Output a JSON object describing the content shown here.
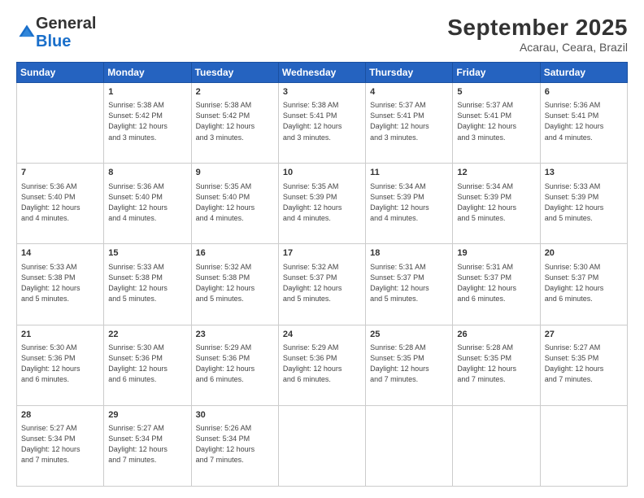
{
  "header": {
    "logo": {
      "line1": "General",
      "line2": "Blue"
    },
    "title": "September 2025",
    "location": "Acarau, Ceara, Brazil"
  },
  "weekdays": [
    "Sunday",
    "Monday",
    "Tuesday",
    "Wednesday",
    "Thursday",
    "Friday",
    "Saturday"
  ],
  "weeks": [
    [
      {
        "day": "",
        "info": ""
      },
      {
        "day": "1",
        "info": "Sunrise: 5:38 AM\nSunset: 5:42 PM\nDaylight: 12 hours\nand 3 minutes."
      },
      {
        "day": "2",
        "info": "Sunrise: 5:38 AM\nSunset: 5:42 PM\nDaylight: 12 hours\nand 3 minutes."
      },
      {
        "day": "3",
        "info": "Sunrise: 5:38 AM\nSunset: 5:41 PM\nDaylight: 12 hours\nand 3 minutes."
      },
      {
        "day": "4",
        "info": "Sunrise: 5:37 AM\nSunset: 5:41 PM\nDaylight: 12 hours\nand 3 minutes."
      },
      {
        "day": "5",
        "info": "Sunrise: 5:37 AM\nSunset: 5:41 PM\nDaylight: 12 hours\nand 3 minutes."
      },
      {
        "day": "6",
        "info": "Sunrise: 5:36 AM\nSunset: 5:41 PM\nDaylight: 12 hours\nand 4 minutes."
      }
    ],
    [
      {
        "day": "7",
        "info": "Sunrise: 5:36 AM\nSunset: 5:40 PM\nDaylight: 12 hours\nand 4 minutes."
      },
      {
        "day": "8",
        "info": "Sunrise: 5:36 AM\nSunset: 5:40 PM\nDaylight: 12 hours\nand 4 minutes."
      },
      {
        "day": "9",
        "info": "Sunrise: 5:35 AM\nSunset: 5:40 PM\nDaylight: 12 hours\nand 4 minutes."
      },
      {
        "day": "10",
        "info": "Sunrise: 5:35 AM\nSunset: 5:39 PM\nDaylight: 12 hours\nand 4 minutes."
      },
      {
        "day": "11",
        "info": "Sunrise: 5:34 AM\nSunset: 5:39 PM\nDaylight: 12 hours\nand 4 minutes."
      },
      {
        "day": "12",
        "info": "Sunrise: 5:34 AM\nSunset: 5:39 PM\nDaylight: 12 hours\nand 5 minutes."
      },
      {
        "day": "13",
        "info": "Sunrise: 5:33 AM\nSunset: 5:39 PM\nDaylight: 12 hours\nand 5 minutes."
      }
    ],
    [
      {
        "day": "14",
        "info": "Sunrise: 5:33 AM\nSunset: 5:38 PM\nDaylight: 12 hours\nand 5 minutes."
      },
      {
        "day": "15",
        "info": "Sunrise: 5:33 AM\nSunset: 5:38 PM\nDaylight: 12 hours\nand 5 minutes."
      },
      {
        "day": "16",
        "info": "Sunrise: 5:32 AM\nSunset: 5:38 PM\nDaylight: 12 hours\nand 5 minutes."
      },
      {
        "day": "17",
        "info": "Sunrise: 5:32 AM\nSunset: 5:37 PM\nDaylight: 12 hours\nand 5 minutes."
      },
      {
        "day": "18",
        "info": "Sunrise: 5:31 AM\nSunset: 5:37 PM\nDaylight: 12 hours\nand 5 minutes."
      },
      {
        "day": "19",
        "info": "Sunrise: 5:31 AM\nSunset: 5:37 PM\nDaylight: 12 hours\nand 6 minutes."
      },
      {
        "day": "20",
        "info": "Sunrise: 5:30 AM\nSunset: 5:37 PM\nDaylight: 12 hours\nand 6 minutes."
      }
    ],
    [
      {
        "day": "21",
        "info": "Sunrise: 5:30 AM\nSunset: 5:36 PM\nDaylight: 12 hours\nand 6 minutes."
      },
      {
        "day": "22",
        "info": "Sunrise: 5:30 AM\nSunset: 5:36 PM\nDaylight: 12 hours\nand 6 minutes."
      },
      {
        "day": "23",
        "info": "Sunrise: 5:29 AM\nSunset: 5:36 PM\nDaylight: 12 hours\nand 6 minutes."
      },
      {
        "day": "24",
        "info": "Sunrise: 5:29 AM\nSunset: 5:36 PM\nDaylight: 12 hours\nand 6 minutes."
      },
      {
        "day": "25",
        "info": "Sunrise: 5:28 AM\nSunset: 5:35 PM\nDaylight: 12 hours\nand 7 minutes."
      },
      {
        "day": "26",
        "info": "Sunrise: 5:28 AM\nSunset: 5:35 PM\nDaylight: 12 hours\nand 7 minutes."
      },
      {
        "day": "27",
        "info": "Sunrise: 5:27 AM\nSunset: 5:35 PM\nDaylight: 12 hours\nand 7 minutes."
      }
    ],
    [
      {
        "day": "28",
        "info": "Sunrise: 5:27 AM\nSunset: 5:34 PM\nDaylight: 12 hours\nand 7 minutes."
      },
      {
        "day": "29",
        "info": "Sunrise: 5:27 AM\nSunset: 5:34 PM\nDaylight: 12 hours\nand 7 minutes."
      },
      {
        "day": "30",
        "info": "Sunrise: 5:26 AM\nSunset: 5:34 PM\nDaylight: 12 hours\nand 7 minutes."
      },
      {
        "day": "",
        "info": ""
      },
      {
        "day": "",
        "info": ""
      },
      {
        "day": "",
        "info": ""
      },
      {
        "day": "",
        "info": ""
      }
    ]
  ]
}
